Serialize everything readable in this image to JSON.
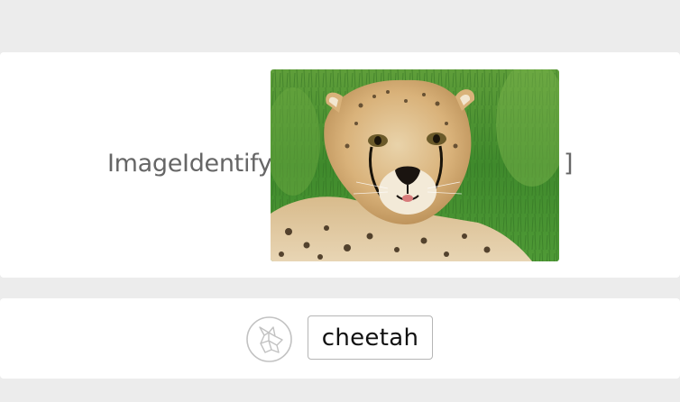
{
  "input": {
    "function_name": "ImageIdentify[",
    "close_bracket": "]",
    "image_subject": "cheetah cub lying in grass"
  },
  "output": {
    "result": "cheetah",
    "icon": "wolf-icon"
  },
  "colors": {
    "background": "#ececec",
    "cell_background": "#ffffff",
    "code_text": "#666666",
    "result_border": "#b5b5b5"
  }
}
